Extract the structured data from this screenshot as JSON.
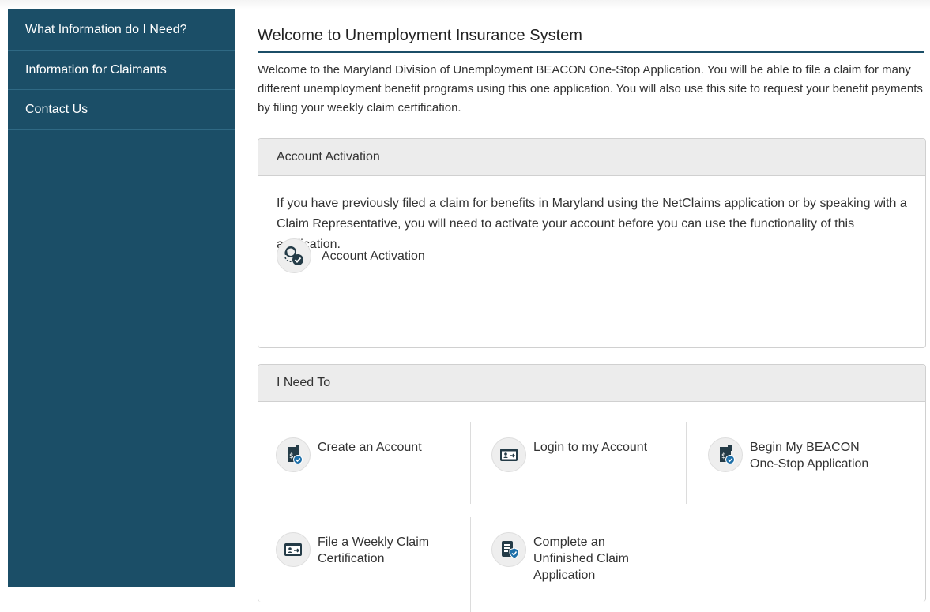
{
  "sidebar": {
    "items": [
      {
        "label": "What Information do I Need?"
      },
      {
        "label": "Information for Claimants"
      },
      {
        "label": "Contact Us"
      }
    ]
  },
  "main": {
    "title": "Welcome to Unemployment Insurance System",
    "intro": "Welcome to the Maryland Division of Unemployment BEACON One-Stop Application. You will be able to file a claim for many different unemployment benefit programs using this one application. You will also use this site to request your benefit payments by filing your weekly claim certification."
  },
  "account_activation": {
    "heading": "Account Activation",
    "body": "If you have previously filed a claim for benefits in Maryland using the NetClaims application or by speaking with a Claim Representative, you will need to activate your account before you can use the functionality of this application.",
    "action": {
      "label": "Account Activation",
      "icon": "account-activation-icon"
    }
  },
  "need_to": {
    "heading": "I Need To",
    "actions": [
      {
        "label": "Create an Account",
        "icon": "create-account-icon"
      },
      {
        "label": "Login to my Account",
        "icon": "login-icon"
      },
      {
        "label": "Begin My BEACON One-Stop Application",
        "icon": "begin-application-icon"
      },
      {
        "label": "File a Weekly Claim Certification",
        "icon": "weekly-claim-icon"
      },
      {
        "label": "Complete an Unfinished Claim Application",
        "icon": "unfinished-claim-icon"
      }
    ]
  },
  "colors": {
    "sidebar": "#1b4e67",
    "icon_dark": "#243b47",
    "check_badge": "#1e6fa8"
  }
}
